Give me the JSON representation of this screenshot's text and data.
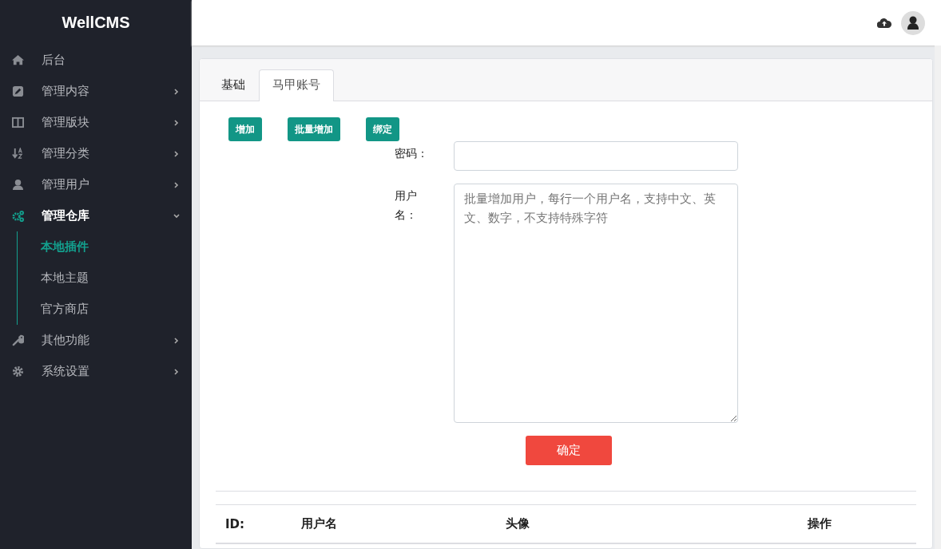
{
  "sidebar": {
    "brand": "WellCMS",
    "items": [
      {
        "label": "后台",
        "expandable": false,
        "expanded": false,
        "selected": false
      },
      {
        "label": "管理内容",
        "expandable": true,
        "expanded": false,
        "selected": false
      },
      {
        "label": "管理版块",
        "expandable": true,
        "expanded": false,
        "selected": false
      },
      {
        "label": "管理分类",
        "expandable": true,
        "expanded": false,
        "selected": false
      },
      {
        "label": "管理用户",
        "expandable": true,
        "expanded": false,
        "selected": false
      },
      {
        "label": "管理仓库",
        "expandable": true,
        "expanded": true,
        "selected": true,
        "children": [
          {
            "label": "本地插件",
            "selected": true
          },
          {
            "label": "本地主题",
            "selected": false
          },
          {
            "label": "官方商店",
            "selected": false
          }
        ]
      },
      {
        "label": "其他功能",
        "expandable": true,
        "expanded": false,
        "selected": false
      },
      {
        "label": "系统设置",
        "expandable": true,
        "expanded": false,
        "selected": false
      }
    ]
  },
  "tabs": [
    {
      "label": "基础",
      "selected": false
    },
    {
      "label": "马甲账号",
      "selected": true
    }
  ],
  "actions": [
    "增加",
    "批量增加",
    "绑定"
  ],
  "form": {
    "fields": [
      {
        "label": "密码：",
        "kind": "input"
      },
      {
        "label": "用户名：",
        "kind": "textarea",
        "placeholder": "批量增加用户，每行一个用户名，支持中文、英文、数字，不支持特殊字符"
      }
    ],
    "submit": "确定"
  },
  "table": {
    "columns": [
      "ID:",
      "用户名",
      "头像",
      "操作"
    ]
  }
}
